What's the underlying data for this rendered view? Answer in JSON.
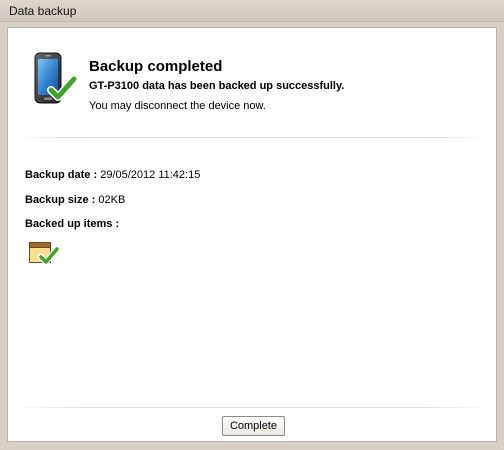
{
  "window": {
    "title": "Data backup"
  },
  "header": {
    "icon": "phone-check-icon",
    "title": "Backup completed",
    "subtitle": "GT-P3100 data has been backed up successfully.",
    "note": "You may disconnect the device now."
  },
  "details": {
    "date_label": "Backup date :",
    "date_value": "29/05/2012 11:42:15",
    "size_label": "Backup size :",
    "size_value": "02KB",
    "items_label": "Backed up items :",
    "item_icon": "calendar-check-icon"
  },
  "footer": {
    "complete_label": "Complete"
  },
  "colors": {
    "frame": "#d6d0c6",
    "panel": "#ffffff",
    "check_green": "#3fa52a"
  }
}
